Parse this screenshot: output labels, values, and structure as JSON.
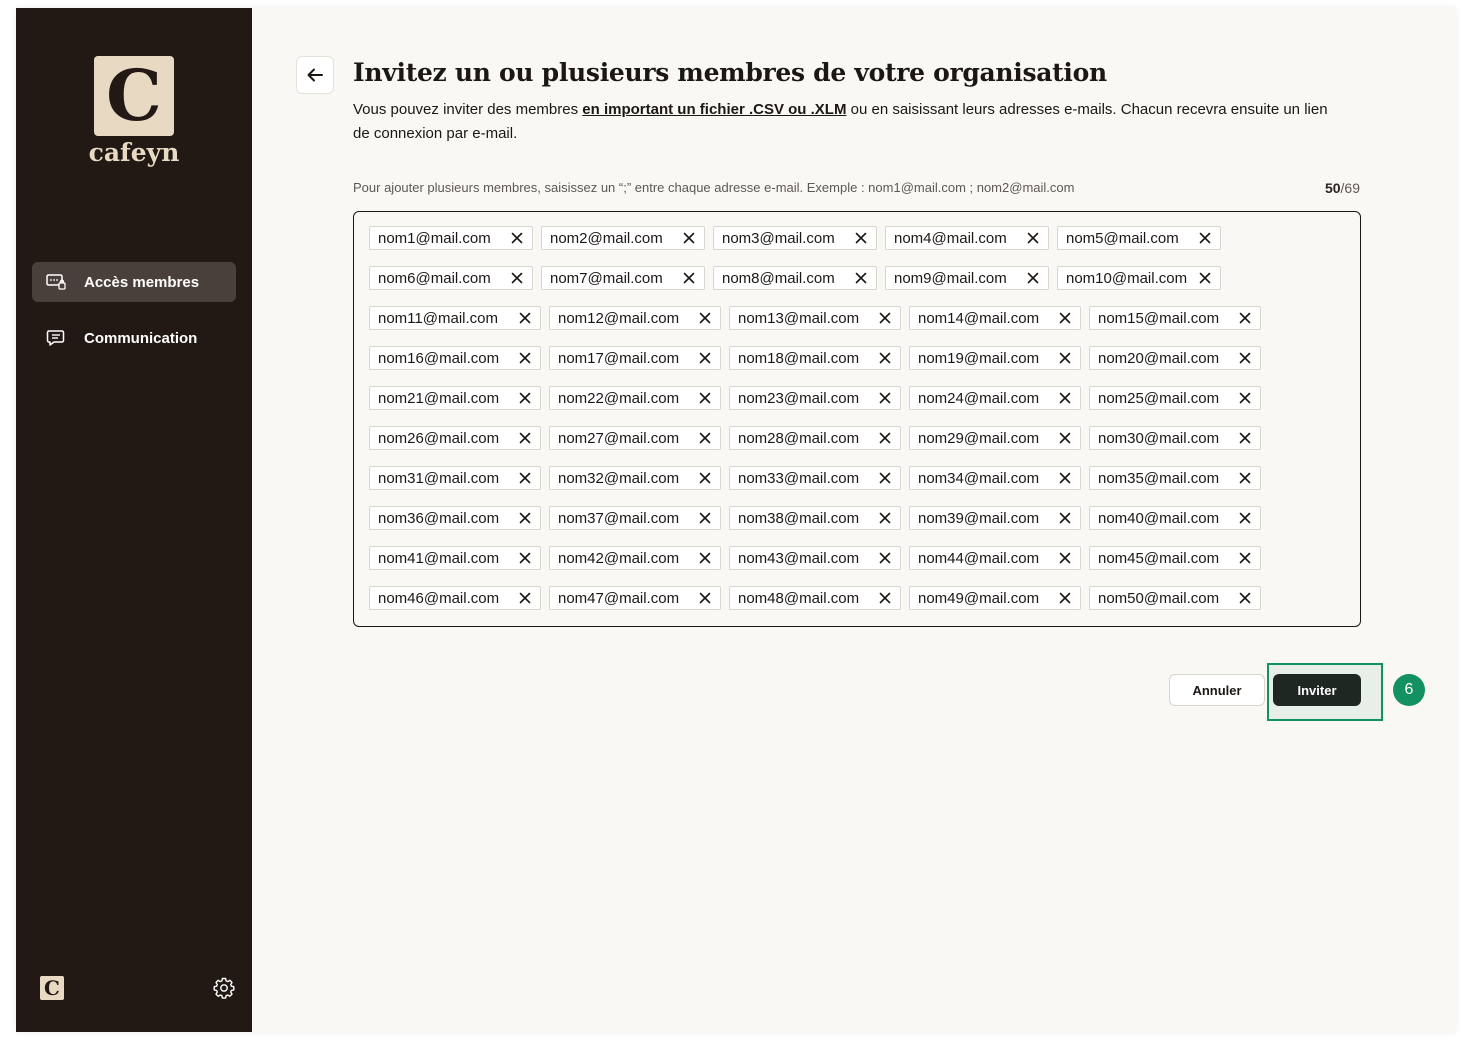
{
  "brand": {
    "logo_letter": "C",
    "name": "cafeyn",
    "small_logo_letter": "C"
  },
  "sidebar": {
    "items": [
      {
        "label": "Accès membres",
        "icon": "members-access-icon",
        "active": true
      },
      {
        "label": "Communication",
        "icon": "message-icon",
        "active": false
      }
    ],
    "settings_icon": "gear-icon"
  },
  "main": {
    "title": "Invitez un ou plusieurs membres de votre organisation",
    "intro_before": "Vous pouvez inviter des membres ",
    "intro_link": "en important un fichier .CSV ou .XLM",
    "intro_after": " ou en saisissant leurs adresses e-mails. Chacun recevra ensuite un lien de connexion par e-mail.",
    "hint": "Pour ajouter plusieurs membres, saisissez un “;” entre chaque adresse e-mail. Exemple : nom1@mail.com ; nom2@mail.com",
    "counter_current": "50",
    "counter_total": "/69",
    "emails": [
      "nom1@mail.com",
      "nom2@mail.com",
      "nom3@mail.com",
      "nom4@mail.com",
      "nom5@mail.com",
      "nom6@mail.com",
      "nom7@mail.com",
      "nom8@mail.com",
      "nom9@mail.com",
      "nom10@mail.com",
      "nom11@mail.com",
      "nom12@mail.com",
      "nom13@mail.com",
      "nom14@mail.com",
      "nom15@mail.com",
      "nom16@mail.com",
      "nom17@mail.com",
      "nom18@mail.com",
      "nom19@mail.com",
      "nom20@mail.com",
      "nom21@mail.com",
      "nom22@mail.com",
      "nom23@mail.com",
      "nom24@mail.com",
      "nom25@mail.com",
      "nom26@mail.com",
      "nom27@mail.com",
      "nom28@mail.com",
      "nom29@mail.com",
      "nom30@mail.com",
      "nom31@mail.com",
      "nom32@mail.com",
      "nom33@mail.com",
      "nom34@mail.com",
      "nom35@mail.com",
      "nom36@mail.com",
      "nom37@mail.com",
      "nom38@mail.com",
      "nom39@mail.com",
      "nom40@mail.com",
      "nom41@mail.com",
      "nom42@mail.com",
      "nom43@mail.com",
      "nom44@mail.com",
      "nom45@mail.com",
      "nom46@mail.com",
      "nom47@mail.com",
      "nom48@mail.com",
      "nom49@mail.com",
      "nom50@mail.com"
    ],
    "cancel_label": "Annuler",
    "invite_label": "Inviter",
    "step_badge": "6"
  },
  "colors": {
    "sidebar_bg": "#221915",
    "brand_beige": "#e8d9c2",
    "accent_green": "#149160",
    "primary_button": "#1f2722"
  }
}
